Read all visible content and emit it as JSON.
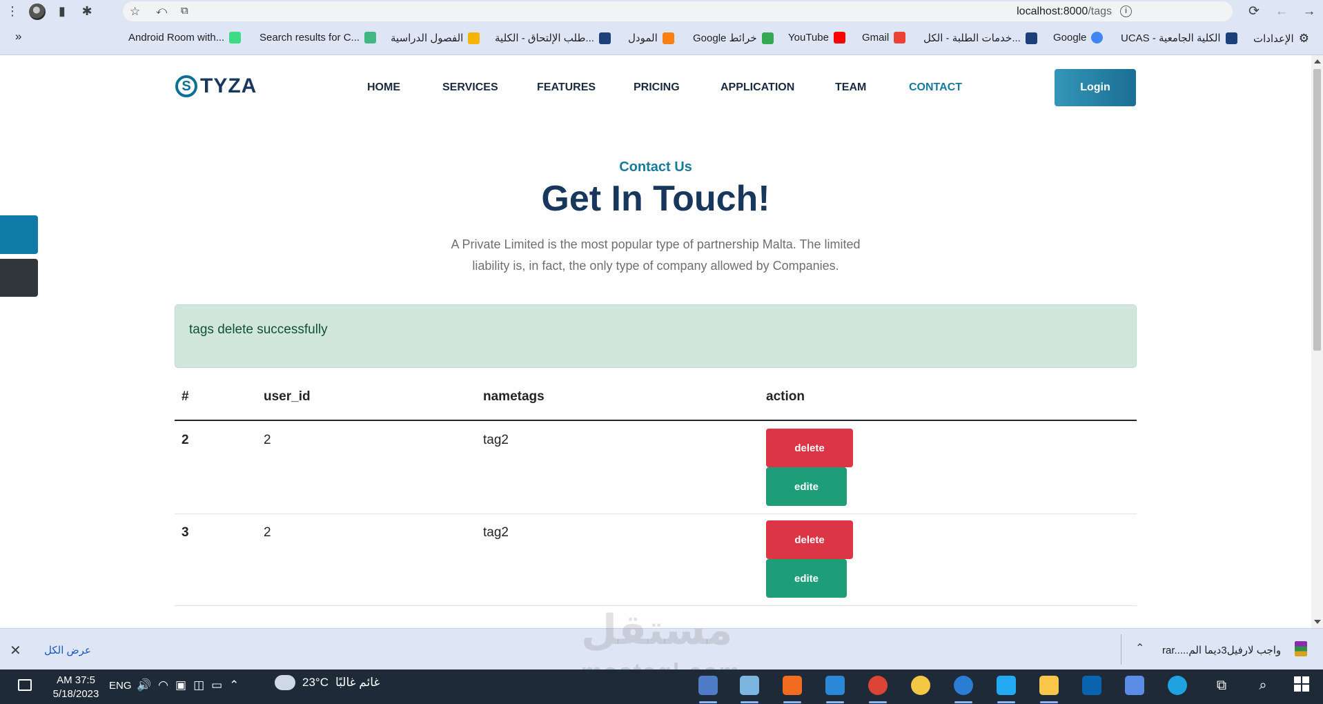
{
  "browser": {
    "url_host": "localhost:8000",
    "url_path": "/tags",
    "bookmarks": [
      "Android Room with...",
      "Search results for C...",
      "الفصول الدراسية",
      "طلب الإلتحاق - الكلية...",
      "المودل",
      "Google خرائط",
      "YouTube",
      "Gmail",
      "خدمات الطلبة - الكل...",
      "Google",
      "UCAS - الكلية الجامعية",
      "الإعدادات"
    ],
    "overflow_label": "»"
  },
  "site": {
    "logo_letter": "S",
    "logo_text": "TYZA",
    "nav": [
      "HOME",
      "SERVICES",
      "FEATURES",
      "PRICING",
      "APPLICATION",
      "TEAM",
      "CONTACT"
    ],
    "active_nav": "CONTACT",
    "login_label": "Login"
  },
  "section": {
    "subtitle": "Contact Us",
    "title": "Get In Touch!",
    "lead": "A Private Limited is the most popular type of partnership Malta. The limited liability is, in fact, the only type of company allowed by Companies."
  },
  "alert": {
    "message": "tags delete successfully"
  },
  "table": {
    "headers": [
      "#",
      "user_id",
      "nametags",
      "action"
    ],
    "rows": [
      {
        "id": "2",
        "user_id": "2",
        "nametags": "tag2",
        "delete_label": "delete",
        "edit_label": "edite"
      },
      {
        "id": "3",
        "user_id": "2",
        "nametags": "tag2",
        "delete_label": "delete",
        "edit_label": "edite"
      }
    ]
  },
  "download_bar": {
    "show_all": "عرض الكل",
    "file_name": "rar.....واجب لارفيل3ديما الم"
  },
  "watermark": {
    "arabic": "مستقل",
    "latin": "mostaql.com"
  },
  "taskbar": {
    "time": "AM 37:5",
    "date": "5/18/2023",
    "language": "ENG",
    "temperature": "23°C",
    "weather_text": "غائم غالبًا"
  },
  "colors": {
    "brand_dark": "#17375c",
    "brand_accent": "#157a9c",
    "alert_bg": "#d1e7dd",
    "delete_btn": "#dc3545",
    "edit_btn": "#1e9e78"
  }
}
